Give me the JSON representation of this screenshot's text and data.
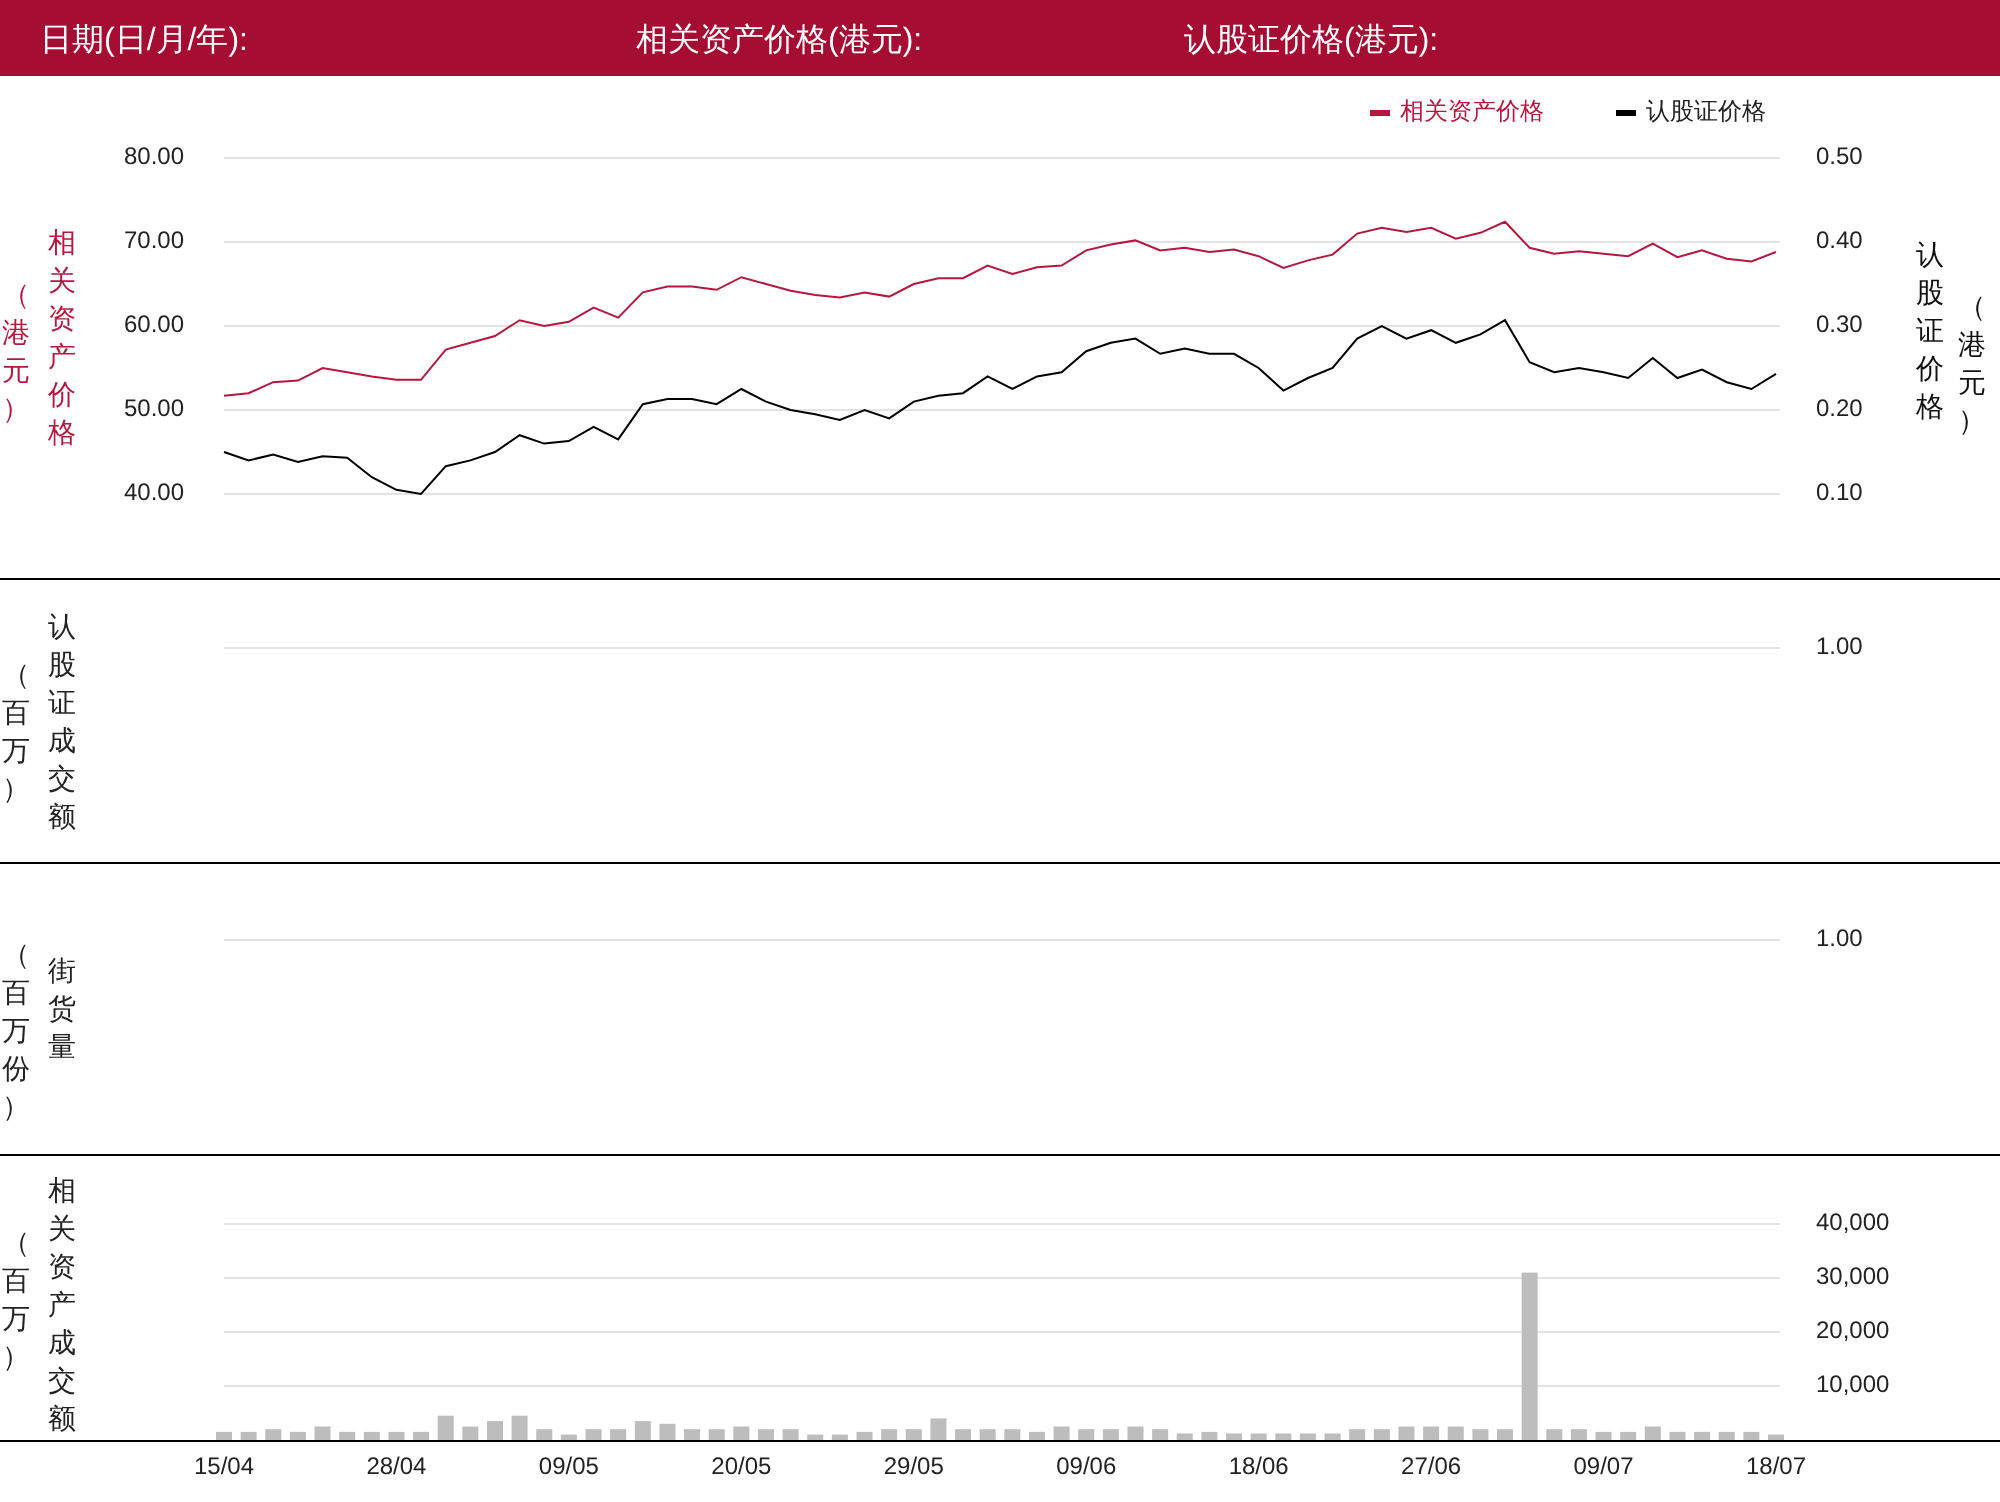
{
  "header": {
    "fields": [
      "日期(日/月/年):",
      "相关资产价格(港元):",
      "认股证价格(港元):"
    ]
  },
  "price_panel": {
    "title_left": "相关资产价格",
    "unit_left": "（港元）",
    "title_right": "认股证价格",
    "unit_right": "（港元）",
    "chart_data": {
      "type": "line",
      "grid": true,
      "legend": "top-right",
      "ylim": [
        40,
        80
      ],
      "yticks": [
        {
          "value": 80,
          "label": "80.00"
        },
        {
          "value": 70,
          "label": "70.00"
        },
        {
          "value": 60,
          "label": "60.00"
        },
        {
          "value": 50,
          "label": "50.00"
        },
        {
          "value": 40,
          "label": "40.00"
        }
      ],
      "series": [
        {
          "name": "相关资产价格",
          "color": "#b5173f",
          "values": [
            51.7,
            52,
            53.3,
            53.5,
            55,
            54.5,
            54,
            53.6,
            53.6,
            57.2,
            58,
            58.8,
            60.7,
            60,
            60.5,
            62.2,
            61,
            64,
            64.7,
            64.7,
            64.3,
            65.8,
            65,
            64.2,
            63.7,
            63.4,
            64,
            63.5,
            65,
            65.7,
            65.7,
            67.2,
            66.2,
            67,
            67.2,
            69,
            69.7,
            70.2,
            69,
            69.3,
            68.8,
            69.1,
            68.3,
            66.9,
            67.8,
            68.5,
            71,
            71.7,
            71.2,
            71.7,
            70.4,
            71.1,
            72.4,
            69.3,
            68.6,
            68.9,
            68.6,
            68.3,
            69.8,
            68.2,
            69,
            68,
            67.7,
            68.8
          ]
        }
      ]
    },
    "right_axis": {
      "chart_data": {
        "type": "line",
        "legend": "top-right",
        "ylim": [
          0.1,
          0.5
        ],
        "yticks": [
          {
            "value": 0.5,
            "label": "0.50"
          },
          {
            "value": 0.4,
            "label": "0.40"
          },
          {
            "value": 0.3,
            "label": "0.30"
          },
          {
            "value": 0.2,
            "label": "0.20"
          },
          {
            "value": 0.1,
            "label": "0.10"
          }
        ],
        "series": [
          {
            "name": "认股证价格",
            "color": "#000000",
            "values": [
              0.15,
              0.14,
              0.147,
              0.138,
              0.145,
              0.143,
              0.12,
              0.105,
              0.1,
              0.133,
              0.14,
              0.15,
              0.17,
              0.16,
              0.163,
              0.18,
              0.165,
              0.207,
              0.213,
              0.213,
              0.207,
              0.225,
              0.21,
              0.2,
              0.195,
              0.188,
              0.2,
              0.19,
              0.21,
              0.217,
              0.22,
              0.24,
              0.225,
              0.24,
              0.245,
              0.27,
              0.28,
              0.285,
              0.267,
              0.273,
              0.267,
              0.267,
              0.25,
              0.223,
              0.238,
              0.25,
              0.285,
              0.3,
              0.285,
              0.295,
              0.28,
              0.29,
              0.307,
              0.257,
              0.245,
              0.25,
              0.245,
              0.238,
              0.262,
              0.238,
              0.248,
              0.233,
              0.225,
              0.243
            ]
          }
        ]
      }
    }
  },
  "turnover_panel": {
    "title": "认股证成交额",
    "unit": "（百万）",
    "tick": "1.00"
  },
  "outstanding_panel": {
    "title": "街货量",
    "unit": "（百万份）",
    "tick": "1.00"
  },
  "asset_turnover_panel": {
    "title": "相关资产成交额",
    "unit": "（百万）",
    "chart_data": {
      "type": "bar",
      "grid": true,
      "ylim": [
        0,
        40000
      ],
      "categories": [
        "15/04",
        null,
        null,
        null,
        null,
        null,
        null,
        "28/04",
        null,
        null,
        null,
        null,
        null,
        null,
        "09/05",
        null,
        null,
        null,
        null,
        null,
        null,
        "20/05",
        null,
        null,
        null,
        null,
        null,
        null,
        "29/05",
        null,
        null,
        null,
        null,
        null,
        null,
        "09/06",
        null,
        null,
        null,
        null,
        null,
        null,
        "18/06",
        null,
        null,
        null,
        null,
        null,
        null,
        "27/06",
        null,
        null,
        null,
        null,
        null,
        null,
        "09/07",
        null,
        null,
        null,
        null,
        null,
        null,
        "18/07"
      ],
      "yticks": [
        {
          "value": 40000,
          "label": "40,000"
        },
        {
          "value": 30000,
          "label": "30,000"
        },
        {
          "value": 20000,
          "label": "20,000"
        },
        {
          "value": 10000,
          "label": "10,000"
        }
      ],
      "series": [
        {
          "color": "#bdbdbd",
          "values": [
            1500,
            1500,
            2000,
            1500,
            2500,
            1500,
            1500,
            1500,
            1500,
            4500,
            2500,
            3500,
            4500,
            2000,
            1000,
            2000,
            2000,
            3500,
            3000,
            2000,
            2000,
            2500,
            2000,
            2000,
            1000,
            1000,
            1500,
            2000,
            2000,
            4000,
            2000,
            2000,
            2000,
            1500,
            2500,
            2000,
            2000,
            2500,
            2000,
            1200,
            1500,
            1200,
            1200,
            1200,
            1200,
            1200,
            2000,
            2000,
            2500,
            2500,
            2500,
            2000,
            2000,
            31000,
            2000,
            2000,
            1500,
            1500,
            2500,
            1500,
            1500,
            1500,
            1500,
            1000
          ]
        }
      ]
    }
  }
}
